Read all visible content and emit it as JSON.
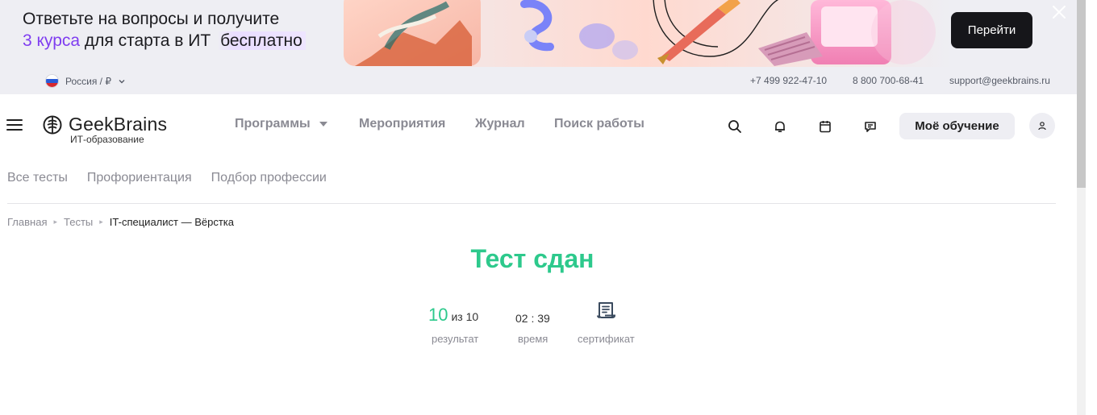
{
  "banner": {
    "line1": "Ответьте на вопросы и получите",
    "line2_accent": "3 курса",
    "line2_mid": "для старта в ИТ",
    "line2_highlight": "бесплатно",
    "button_label": "Перейти"
  },
  "infobar": {
    "region_label": "Россия / ₽",
    "phone1": "+7 499 922-47-10",
    "phone2": "8 800 700-68-41",
    "email": "support@geekbrains.ru"
  },
  "header": {
    "logo_text": "GeekBrains",
    "logo_sub": "ИТ-образование",
    "nav": {
      "programs": "Программы",
      "events": "Мероприятия",
      "journal": "Журнал",
      "jobs": "Поиск работы"
    },
    "learn_button": "Моё обучение"
  },
  "subnav": {
    "all_tests": "Все тесты",
    "career_guidance": "Профориентация",
    "profession_match": "Подбор профессии"
  },
  "breadcrumb": {
    "home": "Главная",
    "tests": "Тесты",
    "current": "IT-специалист — Вёрстка"
  },
  "result": {
    "title": "Тест сдан",
    "score": "10",
    "score_of": "из 10",
    "score_caption": "результат",
    "time": "02 : 39",
    "time_caption": "время",
    "certificate_caption": "сертификат"
  },
  "colors": {
    "accent_green": "#2dc98c",
    "accent_purple": "#7f3df0",
    "banner_bg": "#eeeef3",
    "button_dark": "#16161a"
  },
  "icons": [
    "close-icon",
    "chevron-down-icon",
    "menu-icon",
    "logo-brain-icon",
    "search-icon",
    "bell-icon",
    "calendar-icon",
    "chat-icon",
    "user-icon",
    "certificate-icon"
  ]
}
